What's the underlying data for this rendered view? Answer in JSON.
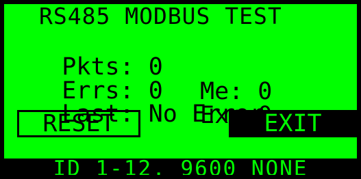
{
  "screen": {
    "title": "RS485 MODBUS TEST"
  },
  "stats": {
    "pkts_label": "Pkts:",
    "pkts_value": "0",
    "me_label": "Me:",
    "me_value": "0",
    "errs_label": "Errs:",
    "errs_value": "0",
    "exc_label": "Exc:",
    "exc_value": "0",
    "last_label": "Last:",
    "last_value": "No Error"
  },
  "buttons": {
    "reset_label": "RESET",
    "exit_label": "EXIT"
  },
  "status": {
    "text": "ID 1-12, 9600 NONE"
  },
  "colors": {
    "screen_bg": "#00ff00",
    "text": "#000000",
    "bezel": "#000000"
  }
}
